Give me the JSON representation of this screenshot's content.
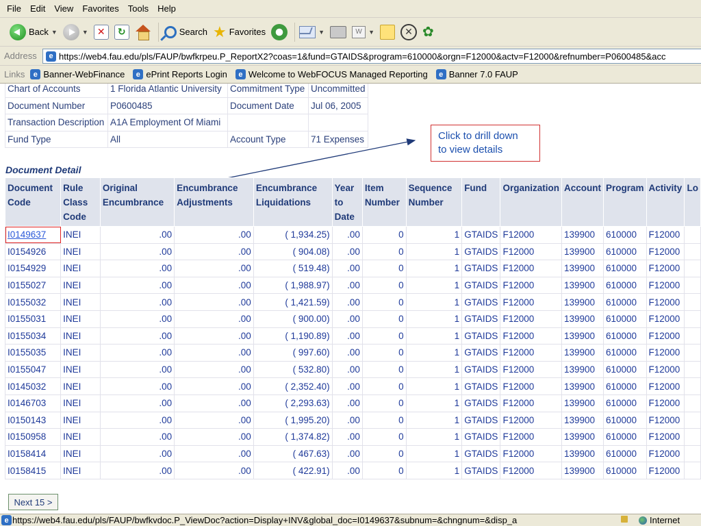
{
  "menu": [
    "File",
    "Edit",
    "View",
    "Favorites",
    "Tools",
    "Help"
  ],
  "toolbar": {
    "back_label": "Back",
    "search_label": "Search",
    "favorites_label": "Favorites"
  },
  "address": {
    "label": "Address",
    "url": "https://web4.fau.edu/pls/FAUP/bwfkrpeu.P_ReportX2?coas=1&fund=GTAIDS&program=610000&orgn=F12000&actv=F12000&refnumber=P0600485&acc"
  },
  "links": {
    "label": "Links",
    "items": [
      "Banner-WebFinance",
      "ePrint Reports Login",
      "Welcome to WebFOCUS Managed Reporting",
      "Banner 7.0 FAUP"
    ]
  },
  "header_info": {
    "rows": [
      [
        "Chart of Accounts",
        "1 Florida Atlantic University",
        "Commitment Type",
        "Uncommitted"
      ],
      [
        "Document Number",
        "P0600485",
        "Document Date",
        "Jul 06, 2005"
      ],
      [
        "Transaction Description",
        "A1A Employment Of Miami",
        "",
        ""
      ],
      [
        "Fund Type",
        "All",
        "Account Type",
        "71 Expenses"
      ]
    ]
  },
  "callout": {
    "line1": "Click to drill down",
    "line2": "to view details"
  },
  "detail": {
    "title": "Document Detail",
    "columns": [
      "Document\nCode",
      "Rule\nClass\nCode",
      "Original\nEncumbrance",
      "Encumbrance\nAdjustments",
      "Encumbrance\nLiquidations",
      "Year\nto\nDate",
      "Item\nNumber",
      "Sequence\nNumber",
      "Fund",
      "Organization",
      "Account",
      "Program",
      "Activity",
      "Lo"
    ],
    "rows": [
      [
        "I0149637",
        "INEI",
        ".00",
        ".00",
        "( 1,934.25)",
        ".00",
        "0",
        "1",
        "GTAIDS",
        "F12000",
        "139900",
        "610000",
        "F12000",
        ""
      ],
      [
        "I0154926",
        "INEI",
        ".00",
        ".00",
        "( 904.08)",
        ".00",
        "0",
        "1",
        "GTAIDS",
        "F12000",
        "139900",
        "610000",
        "F12000",
        ""
      ],
      [
        "I0154929",
        "INEI",
        ".00",
        ".00",
        "( 519.48)",
        ".00",
        "0",
        "1",
        "GTAIDS",
        "F12000",
        "139900",
        "610000",
        "F12000",
        ""
      ],
      [
        "I0155027",
        "INEI",
        ".00",
        ".00",
        "( 1,988.97)",
        ".00",
        "0",
        "1",
        "GTAIDS",
        "F12000",
        "139900",
        "610000",
        "F12000",
        ""
      ],
      [
        "I0155032",
        "INEI",
        ".00",
        ".00",
        "( 1,421.59)",
        ".00",
        "0",
        "1",
        "GTAIDS",
        "F12000",
        "139900",
        "610000",
        "F12000",
        ""
      ],
      [
        "I0155031",
        "INEI",
        ".00",
        ".00",
        "( 900.00)",
        ".00",
        "0",
        "1",
        "GTAIDS",
        "F12000",
        "139900",
        "610000",
        "F12000",
        ""
      ],
      [
        "I0155034",
        "INEI",
        ".00",
        ".00",
        "( 1,190.89)",
        ".00",
        "0",
        "1",
        "GTAIDS",
        "F12000",
        "139900",
        "610000",
        "F12000",
        ""
      ],
      [
        "I0155035",
        "INEI",
        ".00",
        ".00",
        "( 997.60)",
        ".00",
        "0",
        "1",
        "GTAIDS",
        "F12000",
        "139900",
        "610000",
        "F12000",
        ""
      ],
      [
        "I0155047",
        "INEI",
        ".00",
        ".00",
        "( 532.80)",
        ".00",
        "0",
        "1",
        "GTAIDS",
        "F12000",
        "139900",
        "610000",
        "F12000",
        ""
      ],
      [
        "I0145032",
        "INEI",
        ".00",
        ".00",
        "( 2,352.40)",
        ".00",
        "0",
        "1",
        "GTAIDS",
        "F12000",
        "139900",
        "610000",
        "F12000",
        ""
      ],
      [
        "I0146703",
        "INEI",
        ".00",
        ".00",
        "( 2,293.63)",
        ".00",
        "0",
        "1",
        "GTAIDS",
        "F12000",
        "139900",
        "610000",
        "F12000",
        ""
      ],
      [
        "I0150143",
        "INEI",
        ".00",
        ".00",
        "( 1,995.20)",
        ".00",
        "0",
        "1",
        "GTAIDS",
        "F12000",
        "139900",
        "610000",
        "F12000",
        ""
      ],
      [
        "I0150958",
        "INEI",
        ".00",
        ".00",
        "( 1,374.82)",
        ".00",
        "0",
        "1",
        "GTAIDS",
        "F12000",
        "139900",
        "610000",
        "F12000",
        ""
      ],
      [
        "I0158414",
        "INEI",
        ".00",
        ".00",
        "( 467.63)",
        ".00",
        "0",
        "1",
        "GTAIDS",
        "F12000",
        "139900",
        "610000",
        "F12000",
        ""
      ],
      [
        "I0158415",
        "INEI",
        ".00",
        ".00",
        "( 422.91)",
        ".00",
        "0",
        "1",
        "GTAIDS",
        "F12000",
        "139900",
        "610000",
        "F12000",
        ""
      ]
    ]
  },
  "next_button": "Next 15 >",
  "status": {
    "url": "https://web4.fau.edu/pls/FAUP/bwfkvdoc.P_ViewDoc?action=Display+INV&global_doc=I0149637&subnum=&chngnum=&disp_a",
    "zone": "Internet"
  },
  "colors": {
    "accent_link": "#2b59d9",
    "table_text": "#1f3a9a",
    "header_bg": "#dfe3ec",
    "callout_border": "#d03030"
  }
}
